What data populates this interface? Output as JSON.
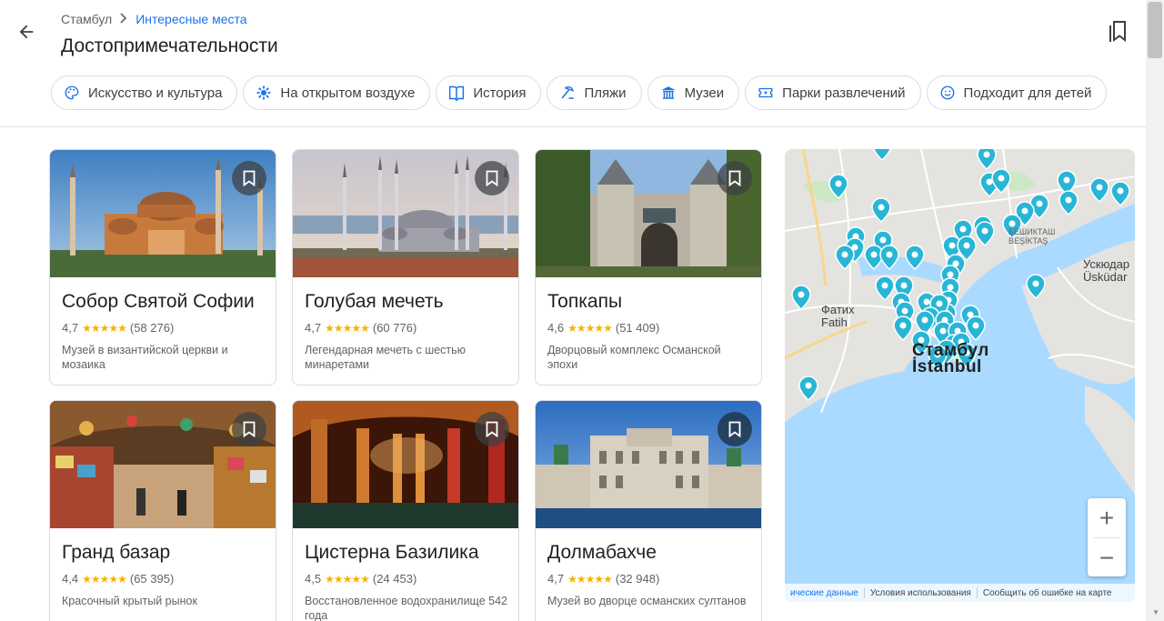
{
  "breadcrumb": {
    "parent": "Стамбул",
    "current": "Интересные места"
  },
  "page_title": "Достопримечательности",
  "chips": [
    {
      "label": "Искусство и культура",
      "icon": "palette-icon"
    },
    {
      "label": "На открытом воздухе",
      "icon": "outdoor-icon"
    },
    {
      "label": "История",
      "icon": "history-icon"
    },
    {
      "label": "Пляжи",
      "icon": "beach-icon"
    },
    {
      "label": "Музеи",
      "icon": "museum-icon"
    },
    {
      "label": "Парки развлечений",
      "icon": "ticket-icon"
    },
    {
      "label": "Подходит для детей",
      "icon": "smile-icon"
    }
  ],
  "places": [
    {
      "name": "Собор Святой Софии",
      "rating": "4,7",
      "stars": "★★★★★",
      "reviews": "(58 276)",
      "desc": "Музей в византийской церкви и мозаика"
    },
    {
      "name": "Голубая мечеть",
      "rating": "4,7",
      "stars": "★★★★★",
      "reviews": "(60 776)",
      "desc": "Легендарная мечеть с шестью минаретами"
    },
    {
      "name": "Топкапы",
      "rating": "4,6",
      "stars": "★★★★★",
      "reviews": "(51 409)",
      "desc": "Дворцовый комплекс Османской эпохи"
    },
    {
      "name": "Гранд базар",
      "rating": "4,4",
      "stars": "★★★★★",
      "reviews": "(65 395)",
      "desc": "Красочный крытый рынок"
    },
    {
      "name": "Цистерна Базилика",
      "rating": "4,5",
      "stars": "★★★★★",
      "reviews": "(24 453)",
      "desc": "Восстановленное водохранилище 542 года"
    },
    {
      "name": "Долмабахче",
      "rating": "4,7",
      "stars": "★★★★★",
      "reviews": "(32 948)",
      "desc": "Музей во дворце османских султанов"
    }
  ],
  "map": {
    "labels": {
      "fatih": "Фатих",
      "fatih_latin": "Fatih",
      "istanbul": "Стамбул",
      "istanbul_latin": "İstanbul",
      "uskudar": "Ускюдар",
      "uskudar_latin": "Üsküdar",
      "besiktas": "БЕШИКТАШ",
      "besiktas_latin": "BEŞİKTAŞ"
    },
    "zoom_in": "+",
    "zoom_out": "−",
    "footer": {
      "data": "ические данные",
      "terms": "Условия использования",
      "report": "Сообщить об ошибке на карте"
    },
    "pin_color": "#29b6d6",
    "water_color": "#aadaff"
  },
  "colors": {
    "accent": "#1a73e8",
    "star": "#f4b400"
  }
}
